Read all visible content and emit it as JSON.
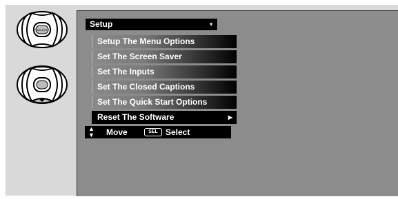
{
  "remote": {
    "select_key_label": "SELECT"
  },
  "menu": {
    "header": "Setup",
    "items": [
      {
        "label": "Setup The Menu Options"
      },
      {
        "label": "Set The Screen Saver"
      },
      {
        "label": "Set The Inputs"
      },
      {
        "label": "Set The Closed Captions"
      },
      {
        "label": "Set The Quick Start Options"
      },
      {
        "label": "Reset The Software",
        "selected": true
      }
    ]
  },
  "help": {
    "move_label": "Move",
    "sel_key": "SEL",
    "select_label": "Select"
  },
  "colors": {
    "screen_bg": "#8c8c8c",
    "frame_bg": "#d9d9d9",
    "menu_selected": "#000000"
  }
}
